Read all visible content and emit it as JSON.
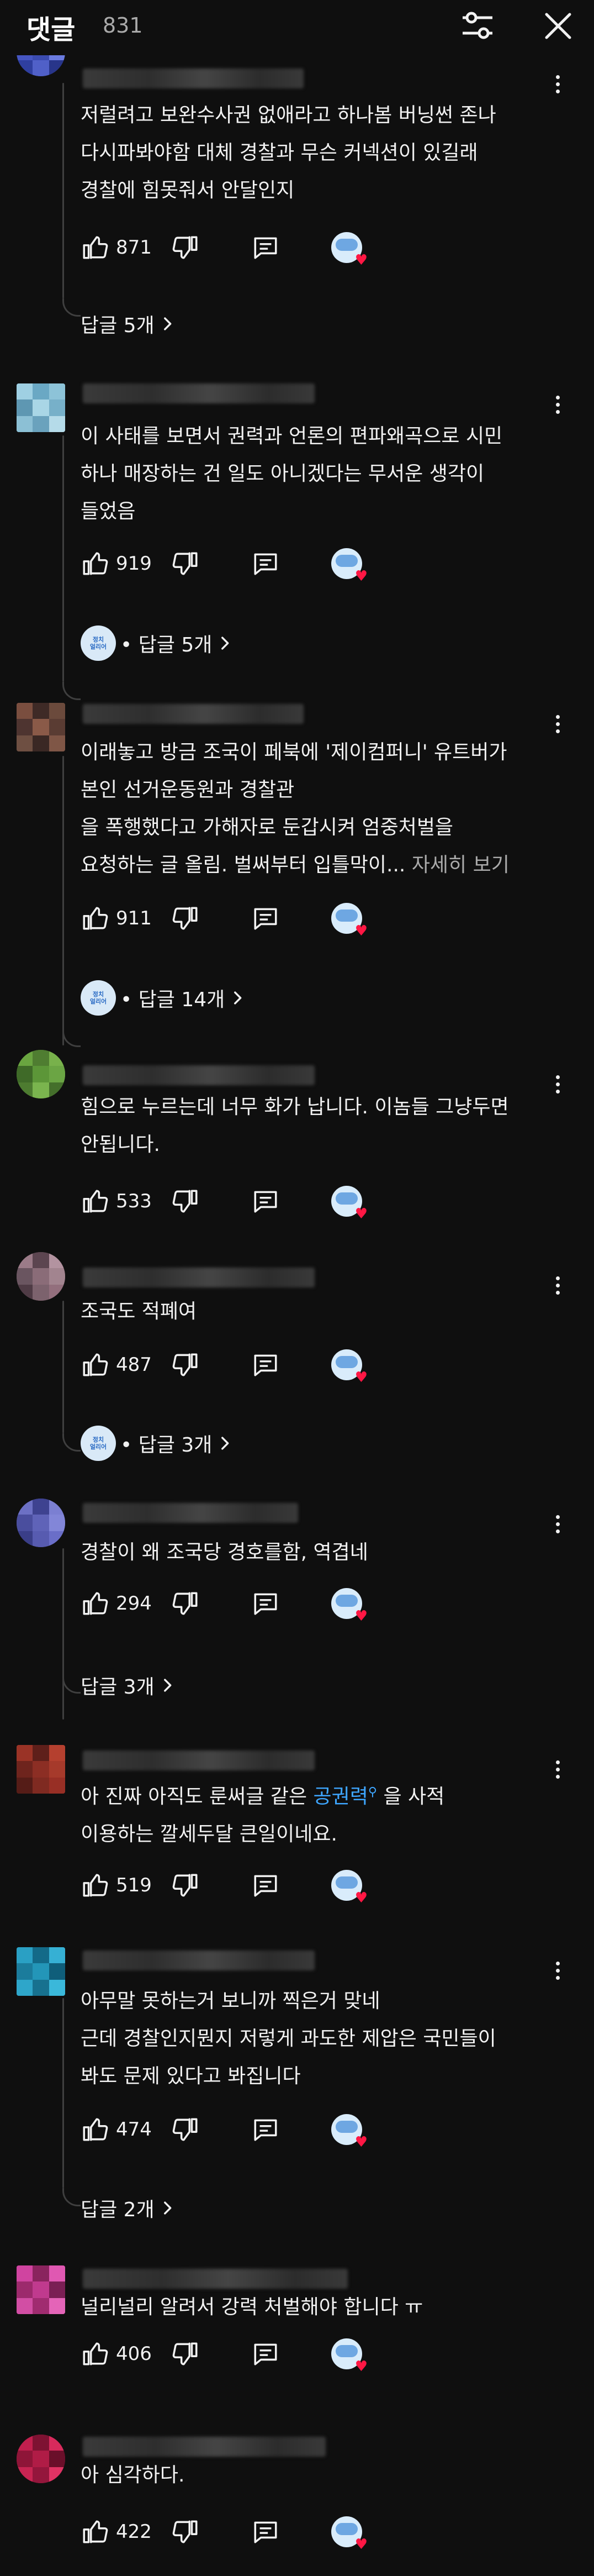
{
  "header": {
    "title": "댓글",
    "count": "831"
  },
  "colors": {
    "background": "#0f0f0f",
    "text": "#f1f1f1",
    "muted": "#aaaaaa",
    "link": "#3ea6ff",
    "heart": "#ff1744"
  },
  "comments": [
    {
      "text": "저럴려고 보완수사권 없애라고 하나봄 버닝썬 존나\n다시파봐야함 대체 경찰과 무슨 커넥션이 있길래\n경찰에 힘못줘서 안달인지",
      "likes": "871",
      "replies_label": "답글 5개"
    },
    {
      "text": "이 사태를 보면서 권력과 언론의 편파왜곡으로 시민\n하나 매장하는 건 일도 아니겠다는 무서운 생각이\n들었음",
      "likes": "919",
      "replies_label": "• 답글 5개"
    },
    {
      "text": "이래놓고 방금 조국이 페북에 '제이컴퍼니' 유트버가\n본인 선거운동원과 경찰관\n을 폭행했다고 가해자로 둔갑시켜 엄중처벌을\n요청하는 글 올림. 벌써부터 입틀막이...",
      "more_label": "자세히 보기",
      "likes": "911",
      "replies_label": "• 답글 14개"
    },
    {
      "text": "힘으로 누르는데 너무 화가 납니다. 이놈들 그냥두면\n안됩니다.",
      "likes": "533"
    },
    {
      "text": "조국도 적폐여",
      "likes": "487",
      "replies_label": "• 답글 3개"
    },
    {
      "text": "경찰이 왜 조국당 경호를함, 역겹네",
      "likes": "294",
      "replies_label": "답글 3개"
    },
    {
      "text_before": "아 진짜 아직도 룬써글 같은 ",
      "link_text": "공권력",
      "text_after": " 을 사적\n이용하는 깔세두달 큰일이네요.",
      "likes": "519"
    },
    {
      "text": "아무말 못하는거 보니까 찍은거 맞네\n근데 경찰인지뭔지 저렇게 과도한 제압은 국민들이\n봐도 문제 있다고 봐집니다",
      "likes": "474",
      "replies_label": "답글 2개"
    },
    {
      "text": "널리널리 알려서 강력 처벌해야 합니다 ㅠ",
      "likes": "406"
    },
    {
      "text": "아 심각하다.",
      "likes": "422"
    }
  ],
  "mini_avatar_label": "정치\n얼리어"
}
